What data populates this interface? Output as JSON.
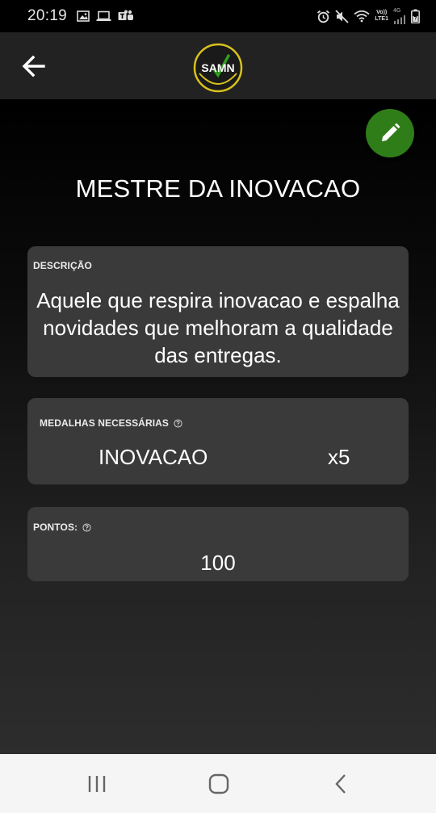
{
  "status_bar": {
    "time": "20:19",
    "network_label_top": "Vo))",
    "network_label_bottom": "LTE1",
    "generation": "4G"
  },
  "app_bar": {
    "logo_text": "SAMN"
  },
  "page": {
    "title": "MESTRE DA INOVACAO"
  },
  "description": {
    "label": "DESCRIÇÃO",
    "text": "Aquele que respira inovacao e espalha novidades que melhoram a qualidade das entregas."
  },
  "medals": {
    "label": "MEDALHAS NECESSÁRIAS",
    "name": "INOVACAO",
    "count": "x5"
  },
  "points": {
    "label": "PONTOS:",
    "value": "100"
  },
  "colors": {
    "accent_green": "#2f7d18",
    "logo_yellow": "#d8c21c",
    "card_bg": "#3a3a3a"
  }
}
